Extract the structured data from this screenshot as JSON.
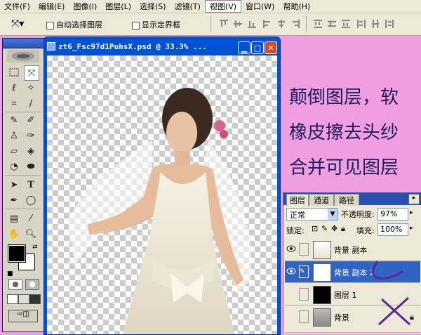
{
  "menu": [
    "文件(F)",
    "编辑(E)",
    "图像(I)",
    "图层(L)",
    "选择(S)",
    "滤镜(T)",
    "视图(V)",
    "窗口(W)",
    "帮助(H)"
  ],
  "options": {
    "auto_select": "自动选择图层",
    "show_bounds": "显示定界框"
  },
  "document": {
    "title": "zt6_Fsc97d1PuhsX.psd @ 33.3% ..."
  },
  "notes": [
    "颠倒图层，软",
    "橡皮擦去头纱",
    "合并可见图层"
  ],
  "layers_panel": {
    "tabs": [
      "图层",
      "通道",
      "路径"
    ],
    "blend_mode": "正常",
    "opacity_label": "不透明度:",
    "opacity_value": "97%",
    "lock_label": "锁定:",
    "fill_label": "填充:",
    "fill_value": "100%",
    "layers": [
      {
        "name": "背景 副本",
        "visible": true,
        "selected": false
      },
      {
        "name": "背景 副本 2",
        "visible": true,
        "selected": true
      },
      {
        "name": "图层 1",
        "visible": false,
        "selected": false
      },
      {
        "name": "背景",
        "visible": false,
        "selected": false
      }
    ]
  },
  "colors": {
    "foreground": "#000000",
    "background": "#ffffff",
    "workspace": "#f09ee0",
    "title_bar": "#0052d4",
    "selection": "#3163c5"
  }
}
